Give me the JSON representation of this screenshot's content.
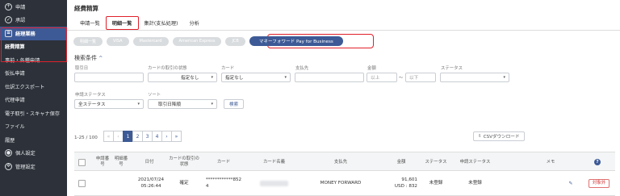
{
  "sidebar": {
    "items": [
      {
        "label": "申請",
        "icon": "plus-circle-icon"
      },
      {
        "label": "承認",
        "icon": "check-circle-icon"
      },
      {
        "label": "経理業務",
        "icon": "document-icon"
      },
      {
        "label": "経費精算",
        "icon": ""
      },
      {
        "label": "事前・各種申請",
        "icon": ""
      },
      {
        "label": "仮払申請",
        "icon": ""
      },
      {
        "label": "仕訳エクスポート",
        "icon": ""
      },
      {
        "label": "代理申請",
        "icon": ""
      },
      {
        "label": "電子取引・スキャナ保存",
        "icon": ""
      },
      {
        "label": "ファイル",
        "icon": ""
      },
      {
        "label": "履歴",
        "icon": ""
      },
      {
        "label": "個人設定",
        "icon": "person-icon"
      },
      {
        "label": "管理設定",
        "icon": "gear-icon"
      }
    ]
  },
  "header": {
    "title": "経費精算"
  },
  "tabs": [
    "申請一覧",
    "明細一覧",
    "集計(支払処理)",
    "分析"
  ],
  "cards": [
    "明細一覧",
    "VISA",
    "Mastercard",
    "American Express",
    "JCB",
    "マネーフォワード Pay for Business"
  ],
  "filters": {
    "title": "検索条件",
    "caret": "^",
    "labels": {
      "date": "取引日",
      "card_status": "カードの取引の状態",
      "card": "カード",
      "payee": "支払先",
      "amount": "金額",
      "status": "ステータス",
      "apply_status": "申請ステータス",
      "sort": "ソート"
    },
    "card_status_value": "指定なし",
    "card_value": "指定なし",
    "amount_min_placeholder": "以上",
    "amount_sep": "〜",
    "amount_max_placeholder": "以下",
    "apply_status_value": "全ステータス",
    "sort_value": "取引日降順",
    "search_label": "検索"
  },
  "pager": {
    "info": "1-25 / 100",
    "first": "«",
    "prev": "‹",
    "pages": [
      "1",
      "2",
      "3",
      "4"
    ],
    "next": "›",
    "last": "»",
    "current": "1"
  },
  "csv_label": "CSVダウンロード",
  "table": {
    "headers": [
      "申請番号",
      "明細番号",
      "日付",
      "カードの取引の状態",
      "カード",
      "カード名義",
      "支払先",
      "金額",
      "ステータス",
      "申請ステータス",
      "メモ"
    ],
    "help": "?",
    "rows": [
      {
        "date": "2021/07/24",
        "time": "05:26:44",
        "card_status": "確定",
        "card": "************852",
        "card_suffix": "4",
        "card_holder": "████████",
        "payee": "MONEY FORWARD",
        "amount_jpy": "91,601",
        "amount_usd": "USD : 832",
        "status": "未登録",
        "apply_status": "未登録",
        "edit": "✎",
        "badge": "対象外"
      }
    ]
  },
  "colors": {
    "sidebar_bg": "#2d323a",
    "accent": "#3d5a96",
    "highlight": "#e0202a"
  }
}
